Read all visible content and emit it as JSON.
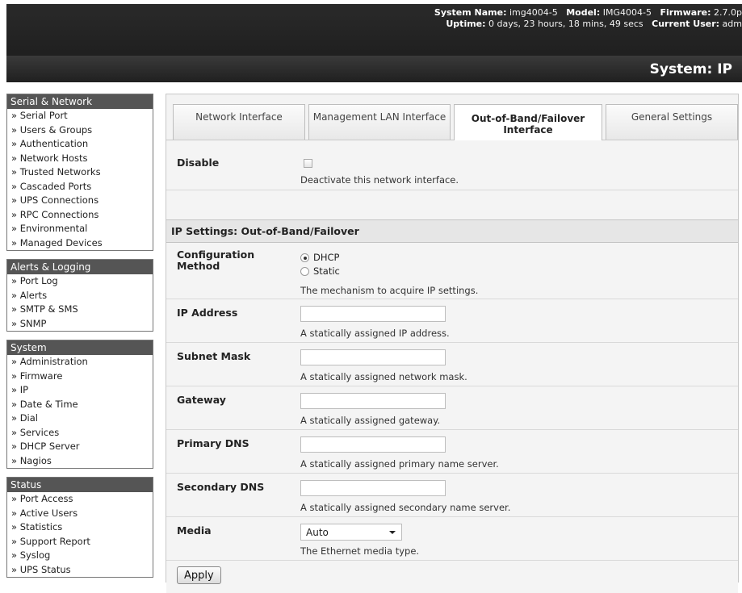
{
  "header": {
    "system_name_label": "System Name:",
    "system_name_value": "img4004-5",
    "model_label": "Model:",
    "model_value": "IMG4004-5",
    "firmware_label": "Firmware:",
    "firmware_value": "2.7.0p",
    "uptime_label": "Uptime:",
    "uptime_value": "0 days, 23 hours, 18 mins, 49 secs",
    "current_user_label": "Current User:",
    "current_user_value": "adm",
    "page_title": "System: IP"
  },
  "sidebar": {
    "menus": [
      {
        "title": "Serial & Network",
        "items": [
          "» Serial Port",
          "» Users & Groups",
          "» Authentication",
          "» Network Hosts",
          "» Trusted Networks",
          "» Cascaded Ports",
          "» UPS Connections",
          "» RPC Connections",
          "» Environmental",
          "» Managed Devices"
        ]
      },
      {
        "title": "Alerts & Logging",
        "items": [
          "» Port Log",
          "» Alerts",
          "» SMTP & SMS",
          "» SNMP"
        ]
      },
      {
        "title": "System",
        "items": [
          "» Administration",
          "» Firmware",
          "» IP",
          "» Date & Time",
          "» Dial",
          "» Services",
          "» DHCP Server",
          "» Nagios"
        ]
      },
      {
        "title": "Status",
        "items": [
          "» Port Access",
          "» Active Users",
          "» Statistics",
          "» Support Report",
          "» Syslog",
          "» UPS Status"
        ]
      }
    ]
  },
  "tabs": [
    {
      "label": "Network Interface",
      "active": false
    },
    {
      "label": "Management LAN Interface",
      "active": false
    },
    {
      "label": "Out-of-Band/Failover Interface",
      "active": true
    },
    {
      "label": "General Settings",
      "active": false
    }
  ],
  "form": {
    "disable": {
      "label": "Disable",
      "checked": false,
      "help": "Deactivate this network interface."
    },
    "section_title": "IP Settings: Out-of-Band/Failover",
    "config_method": {
      "label": "Configuration Method",
      "options": [
        "DHCP",
        "Static"
      ],
      "selected": "DHCP",
      "help": "The mechanism to acquire IP settings."
    },
    "ip_address": {
      "label": "IP Address",
      "value": "",
      "help": "A statically assigned IP address."
    },
    "subnet_mask": {
      "label": "Subnet Mask",
      "value": "",
      "help": "A statically assigned network mask."
    },
    "gateway": {
      "label": "Gateway",
      "value": "",
      "help": "A statically assigned gateway."
    },
    "primary_dns": {
      "label": "Primary DNS",
      "value": "",
      "help": "A statically assigned primary name server."
    },
    "secondary_dns": {
      "label": "Secondary DNS",
      "value": "",
      "help": "A statically assigned secondary name server."
    },
    "media": {
      "label": "Media",
      "value": "Auto",
      "help": "The Ethernet media type."
    },
    "apply_label": "Apply"
  }
}
